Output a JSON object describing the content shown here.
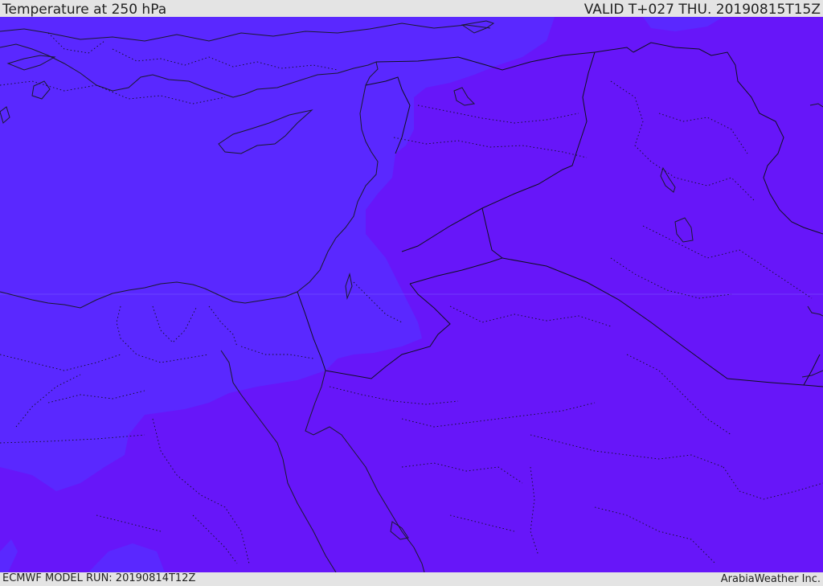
{
  "header": {
    "title": "Temperature at 250 hPa",
    "valid_time": "VALID T+027 THU. 20190815T15Z"
  },
  "footer": {
    "model_run": "ECMWF MODEL RUN: 20190814T12Z",
    "credit": "ArabiaWeather Inc."
  },
  "colors": {
    "temp_band_colder": "#5a28ff",
    "temp_band_warmer": "#6716f9",
    "coastline": "#1a1a2e",
    "border": "#101020",
    "background": "#e4e4e4"
  }
}
